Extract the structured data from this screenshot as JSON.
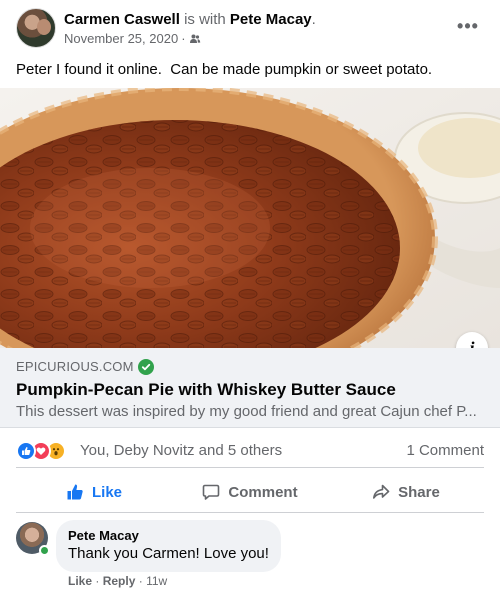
{
  "post": {
    "author": "Carmen Caswell",
    "with_text": "is with",
    "tagged_person": "Pete Macay",
    "date": "November 25, 2020",
    "audience_icon": "friends-icon",
    "text": "Peter I found it online.  Can be made pumpkin or sweet potato."
  },
  "link_preview": {
    "image_description_icon": "pecan-pie-image",
    "domain": "EPICURIOUS.COM",
    "title": "Pumpkin-Pecan Pie with Whiskey Butter Sauce",
    "description": "This dessert was inspired by my good friend and great Cajun chef P..."
  },
  "reactions": {
    "types": [
      "like",
      "love",
      "wow"
    ],
    "names": "You, Deby Novitz and 5 others",
    "comments_count": "1 Comment"
  },
  "actions": {
    "like": "Like",
    "comment": "Comment",
    "share": "Share"
  },
  "comment": {
    "author": "Pete Macay",
    "text": "Thank you Carmen! Love you!",
    "like_label": "Like",
    "reply_label": "Reply",
    "time": "11w"
  },
  "colors": {
    "accent": "#1877f2",
    "secondary_text": "#65676b",
    "bubble": "#f0f2f5",
    "verified": "#31a24c"
  }
}
